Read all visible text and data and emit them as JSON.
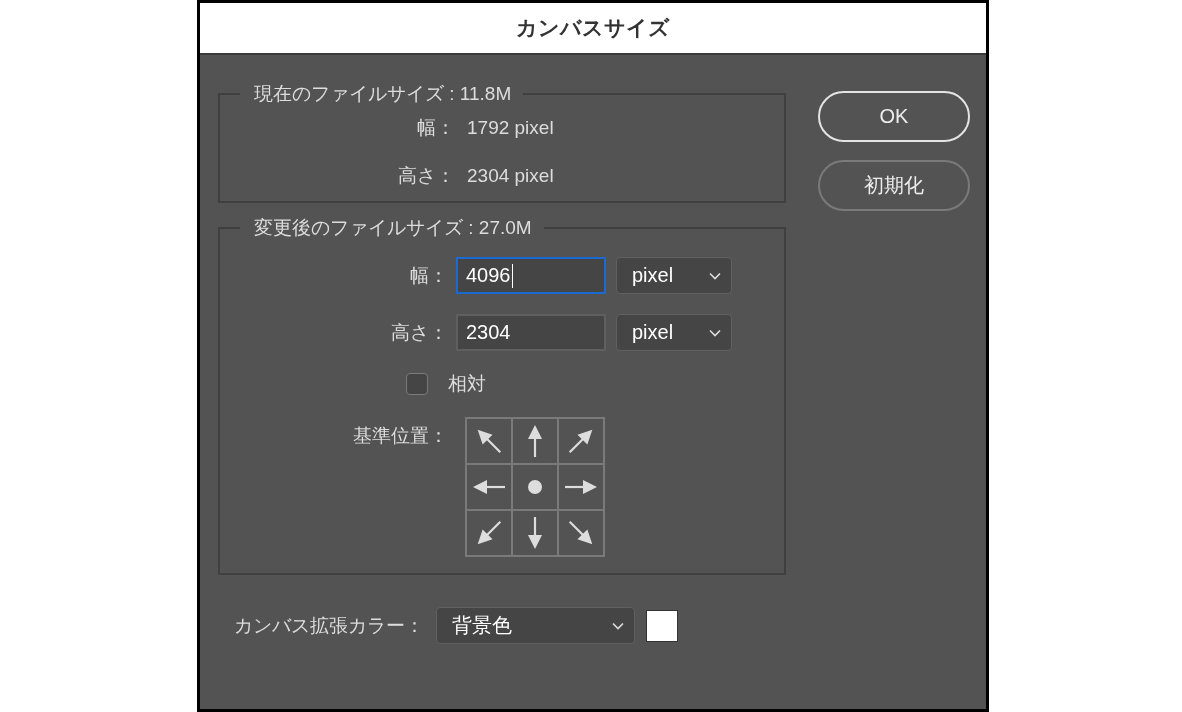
{
  "window": {
    "title": "カンバスサイズ"
  },
  "current_size": {
    "legend": "現在のファイルサイズ : 11.8M",
    "rows": [
      {
        "label": "幅：",
        "value": "1792 pixel"
      },
      {
        "label": "高さ：",
        "value": "2304 pixel"
      }
    ]
  },
  "new_size": {
    "legend": "変更後のファイルサイズ : 27.0M",
    "fields": [
      {
        "label": "幅：",
        "value": "4096",
        "focused": true,
        "unit": "pixel"
      },
      {
        "label": "高さ：",
        "value": "2304",
        "focused": false,
        "unit": "pixel"
      }
    ],
    "relative": {
      "label": "相対",
      "checked": false
    },
    "anchor": {
      "label": "基準位置：",
      "cells": [
        {
          "selected": false
        },
        {
          "selected": false
        },
        {
          "selected": false
        },
        {
          "selected": false
        },
        {
          "selected": true
        },
        {
          "selected": false
        },
        {
          "selected": false
        },
        {
          "selected": false
        },
        {
          "selected": false
        }
      ]
    }
  },
  "extension_color": {
    "label": "カンバス拡張カラー：",
    "value": "背景色"
  },
  "buttons": [
    {
      "label": "OK",
      "default": true
    },
    {
      "label": "初期化",
      "default": false
    }
  ]
}
